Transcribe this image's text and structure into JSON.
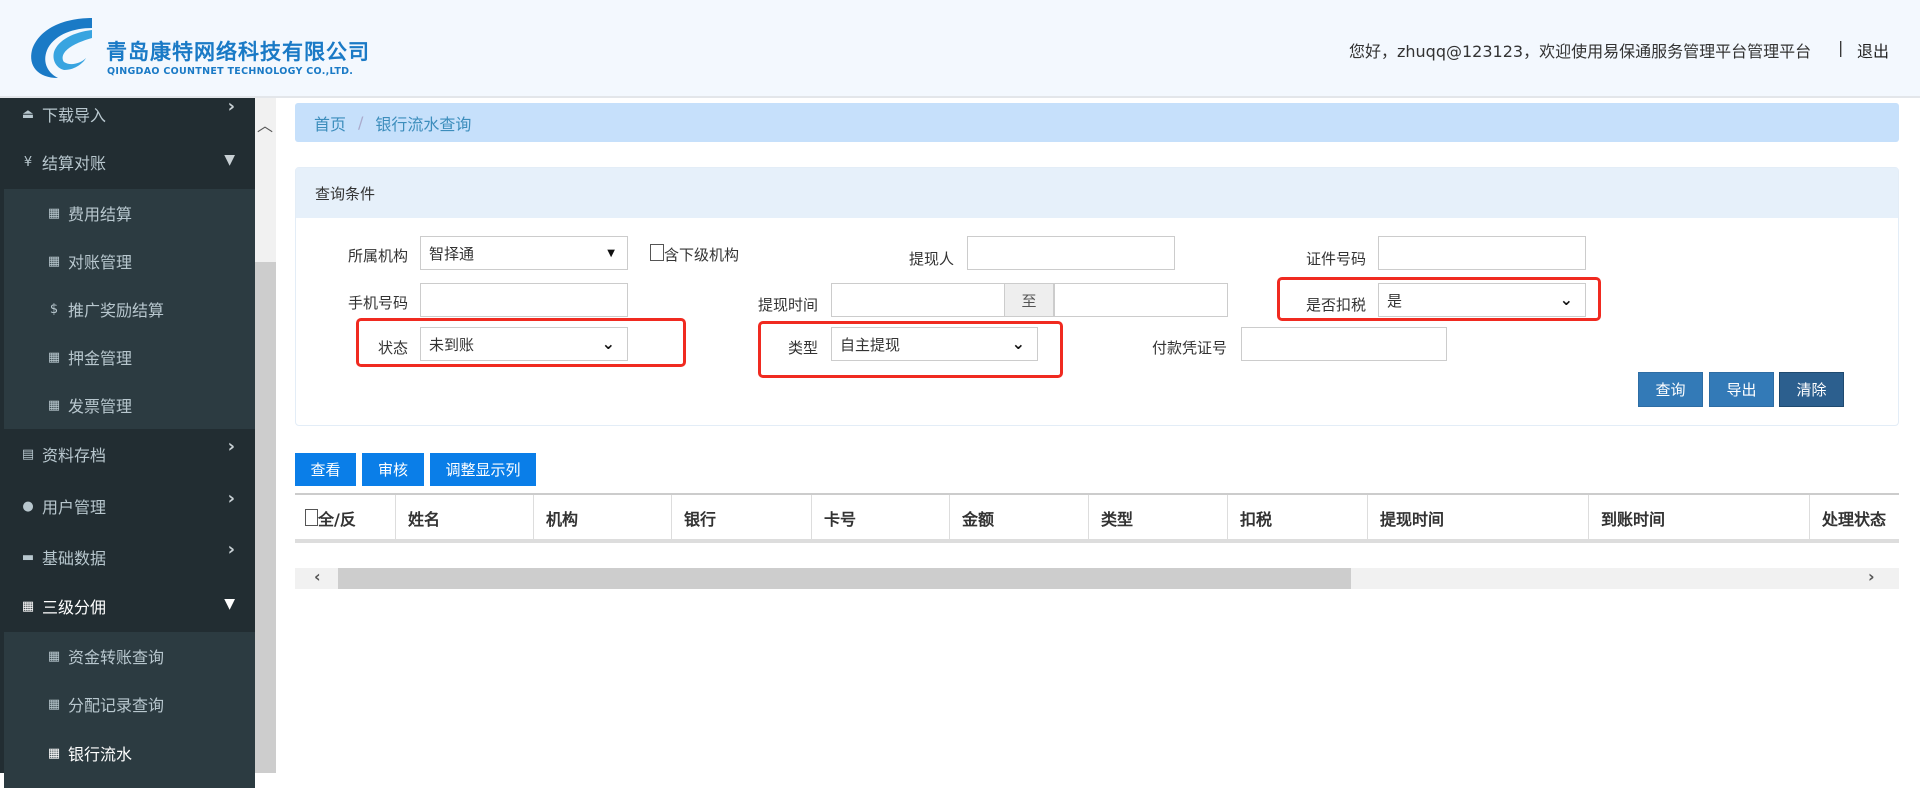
{
  "header": {
    "company_cn": "青岛康特网络科技有限公司",
    "company_en": "QINGDAO COUNTNET TECHNOLOGY CO.,LTD.",
    "welcome": "您好，zhuqq@123123，欢迎使用易保通服务管理平台管理平台",
    "separator": "|",
    "logout": "退出",
    "brand_color": "#1a7ac6"
  },
  "sidebar": {
    "items": [
      {
        "label": "下载导入",
        "icon": "download-icon"
      },
      {
        "label": "结算对账",
        "icon": "yen-icon"
      },
      {
        "label": "费用结算",
        "icon": "grid-icon"
      },
      {
        "label": "对账管理",
        "icon": "grid-icon"
      },
      {
        "label": "推广奖励结算",
        "icon": "dollar-icon"
      },
      {
        "label": "押金管理",
        "icon": "grid-icon"
      },
      {
        "label": "发票管理",
        "icon": "grid-icon"
      },
      {
        "label": "资料存档",
        "icon": "list-icon"
      },
      {
        "label": "用户管理",
        "icon": "user-icon"
      },
      {
        "label": "基础数据",
        "icon": "hdd-icon"
      },
      {
        "label": "三级分佣",
        "icon": "grid-icon"
      },
      {
        "label": "资金转账查询",
        "icon": "grid-icon"
      },
      {
        "label": "分配记录查询",
        "icon": "grid-icon"
      },
      {
        "label": "银行流水",
        "icon": "grid-icon"
      }
    ]
  },
  "breadcrumb": {
    "home": "首页",
    "sep": "/",
    "current": "银行流水查询"
  },
  "query": {
    "title": "查询条件",
    "org_label": "所属机构",
    "org_value": "智择通",
    "include_sub_label": "含下级机构",
    "withdrawer_label": "提现人",
    "withdrawer_value": "",
    "id_label": "证件号码",
    "id_value": "",
    "phone_label": "手机号码",
    "phone_value": "",
    "time_label": "提现时间",
    "time_from": "",
    "time_to_label": "至",
    "time_to": "",
    "tax_label": "是否扣税",
    "tax_value": "是",
    "status_label": "状态",
    "status_value": "未到账",
    "type_label": "类型",
    "type_value": "自主提现",
    "voucher_label": "付款凭证号",
    "voucher_value": "",
    "search": "查询",
    "export": "导出",
    "clear": "清除"
  },
  "toolbar": {
    "view": "查看",
    "audit": "审核",
    "columns": "调整显示列"
  },
  "table": {
    "columns": [
      "全/反",
      "姓名",
      "机构",
      "银行",
      "卡号",
      "金额",
      "类型",
      "扣税",
      "提现时间",
      "到账时间",
      "处理状态"
    ]
  }
}
